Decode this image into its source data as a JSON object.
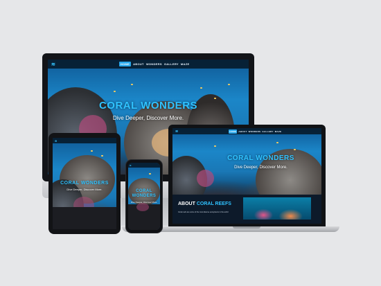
{
  "site": {
    "brand_icon": "wave-logo-icon",
    "nav": [
      "HOME",
      "ABOUT",
      "WONDERS",
      "GALLERY",
      "MAZE"
    ],
    "hero_title": "CORAL WONDERS",
    "hero_subtitle": "Dive Deeper, Discover More.",
    "about_title_prefix": "ABOUT",
    "about_title_accent": "CORAL REEFS",
    "about_text": "Coral reefs are some of the most diverse ecosystems in the world"
  },
  "colors": {
    "accent": "#2fc2ff",
    "active_nav": "#2aa8ec",
    "ocean": "#1b86c8",
    "background": "#e6e7e9"
  }
}
